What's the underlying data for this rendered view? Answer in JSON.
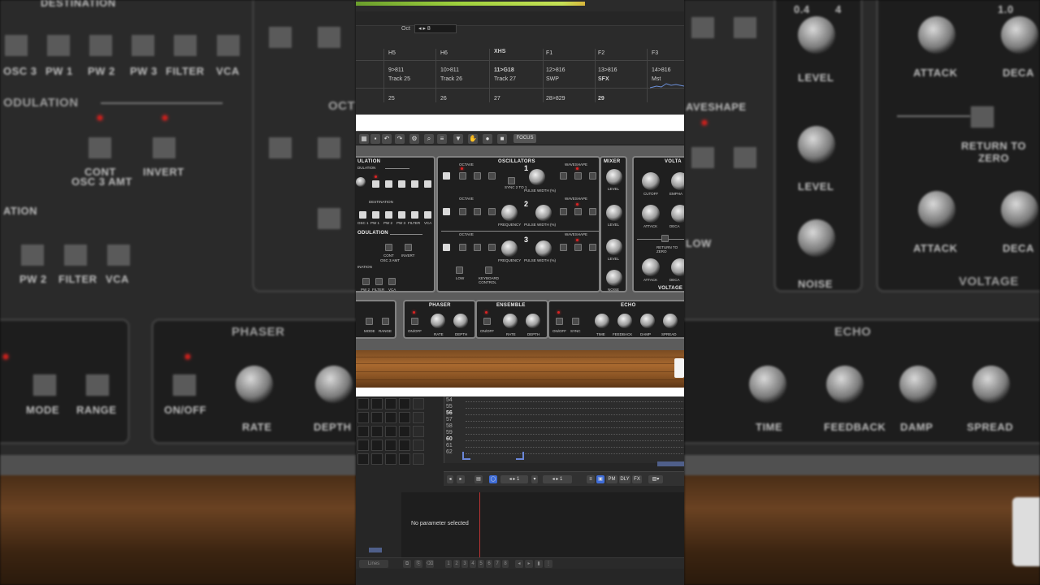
{
  "background_left": {
    "labels": [
      "DESTINATION",
      "OSC 3",
      "PW 1",
      "PW 2",
      "PW 3",
      "FILTER",
      "VCA",
      "ODULATION",
      "CONT",
      "OSC 3 AMT",
      "INVERT",
      "ATION",
      "PW 2",
      "FILTER",
      "VCA",
      "PHASER",
      "MODE",
      "RANGE",
      "ON/OFF",
      "RATE",
      "DEPTH",
      "OCT"
    ],
    "colors": {
      "panel": "#1d1d1d",
      "frame": "#3c3c3c",
      "wood": "#6a4222"
    }
  },
  "background_right": {
    "labels": [
      "0.4",
      "4",
      "1.0",
      "ATTACK",
      "DECA",
      "LEVEL",
      "LEVEL",
      "RETURN TO ZERO",
      "ATTACK",
      "DECA",
      "NOISE",
      "VOLTAGE",
      "ECHO",
      "TIME",
      "FEEDBACK",
      "DAMP",
      "SPREAD",
      "AVESHAPE",
      "LOW"
    ]
  },
  "daw_header": {
    "oct_label": "Oct",
    "oct_value": "◂ ▸ 8"
  },
  "track_table": {
    "headers": [
      "H5",
      "H6",
      "XHS",
      "F1",
      "F2",
      "F3"
    ],
    "steps": [
      "9>811",
      "10>811",
      "11>G18",
      "12>816",
      "13>816",
      "14>816"
    ],
    "names": [
      "Track 25",
      "Track 26",
      "Track 27",
      "SWP",
      "SFX",
      "Mst"
    ],
    "numbers": [
      "25",
      "26",
      "27",
      "28>829",
      "29",
      ""
    ]
  },
  "synth_toolbar": {
    "focus_label": "FOCUS",
    "icons": [
      "grid-icon",
      "undo-icon",
      "redo-icon",
      "settings-icon",
      "search-icon",
      "vst-icon",
      "hand-icon",
      "record-icon",
      "stop-icon"
    ]
  },
  "synth": {
    "modulation": {
      "title": "ULATION",
      "sub": "DULATION",
      "destination": "DESTINATION",
      "dest_labels": [
        "OSC 1",
        "PW 1",
        "PW 2",
        "PW 3",
        "FILTER",
        "VCA"
      ],
      "mod2": "ODULATION",
      "cont": "CONT",
      "osc3amt": "OSC 3 AMT",
      "invert": "INVERT",
      "ination": "INATION",
      "bottom": [
        "PW 2",
        "FILTER",
        "VCA"
      ]
    },
    "oscillators": {
      "title": "OSCILLATORS",
      "octave": "OCTAVE",
      "waveshape": "WAVESHAPE",
      "frequency": "FREQUENCY",
      "pulse_width": "PULSE WIDTH (%)",
      "sync": "SYNC 2 TO 1",
      "nums": [
        "1",
        "2",
        "3"
      ],
      "low": "LOW",
      "kbd": "KEYBOARD CONTROL"
    },
    "mixer": {
      "title": "MIXER",
      "level": "LEVEL",
      "noise": "NOISE"
    },
    "voltage": {
      "title": "VOLTA",
      "title_b": "VOLTAGE",
      "cutoff": "CUTOFF",
      "emphasis": "EMPHA",
      "attack": "ATTACK",
      "decay": "DECA",
      "return": "RETURN TO ZERO"
    },
    "phaser": {
      "title": "PHASER",
      "onoff": "ON/OFF",
      "rate": "RATE",
      "depth": "DEPTH"
    },
    "ensemble": {
      "title": "ENSEMBLE",
      "onoff": "ON/OFF",
      "rate": "RATE",
      "depth": "DEPTH"
    },
    "echo": {
      "title": "ECHO",
      "onoff": "ON/OFF",
      "sync": "SYNC",
      "time": "TIME",
      "feedback": "FEEDBACK",
      "damp": "DAMP",
      "spread": "SPREAD"
    },
    "left_bottom": {
      "mode": "MODE",
      "range": "RANGE"
    }
  },
  "sequencer": {
    "rows": [
      "54",
      "55",
      "56",
      "57",
      "58",
      "59",
      "60",
      "61",
      "62"
    ],
    "toolbar_items": [
      "◂ ▸ 1",
      "◂ ▸ 1",
      "PM",
      "DLY",
      "FX"
    ]
  },
  "automation": {
    "message": "No parameter selected",
    "bottom_items": [
      "Lines",
      "1",
      "2",
      "3",
      "4",
      "5",
      "6",
      "7",
      "8"
    ]
  }
}
